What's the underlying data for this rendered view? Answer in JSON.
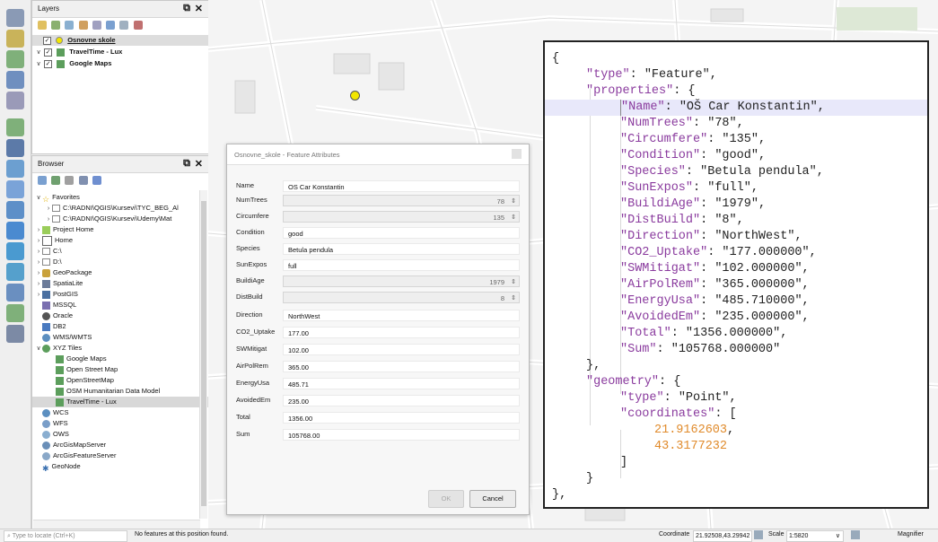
{
  "layers_panel": {
    "title": "Layers",
    "items": [
      {
        "label": "Osnovne skole",
        "checked": true
      },
      {
        "label": "TravelTime - Lux",
        "checked": true
      },
      {
        "label": "Google Maps",
        "checked": true
      }
    ]
  },
  "browser_panel": {
    "title": "Browser",
    "items": [
      {
        "label": "Favorites"
      },
      {
        "label": "C:\\RADNI\\QGIS\\Kursevi\\TYC_BEG_Al"
      },
      {
        "label": "C:\\RADNI\\QGIS\\Kursevi\\Udemy\\Mat"
      },
      {
        "label": "Project Home"
      },
      {
        "label": "Home"
      },
      {
        "label": "C:\\"
      },
      {
        "label": "D:\\"
      },
      {
        "label": "GeoPackage"
      },
      {
        "label": "SpatiaLite"
      },
      {
        "label": "PostGIS"
      },
      {
        "label": "MSSQL"
      },
      {
        "label": "Oracle"
      },
      {
        "label": "DB2"
      },
      {
        "label": "WMS/WMTS"
      },
      {
        "label": "XYZ Tiles"
      },
      {
        "label": "Google Maps"
      },
      {
        "label": "Open Street Map"
      },
      {
        "label": "OpenStreetMap"
      },
      {
        "label": "OSM Humanitarian Data Model"
      },
      {
        "label": "TravelTime - Lux"
      },
      {
        "label": "WCS"
      },
      {
        "label": "WFS"
      },
      {
        "label": "OWS"
      },
      {
        "label": "ArcGisMapServer"
      },
      {
        "label": "ArcGisFeatureServer"
      },
      {
        "label": "GeoNode"
      }
    ]
  },
  "dialog": {
    "title": "Osnovne_skole - Feature Attributes",
    "fields": [
      {
        "label": "Name",
        "value": "OS Car Konstantin"
      },
      {
        "label": "NumTrees",
        "value": "78"
      },
      {
        "label": "Circumfere",
        "value": "135"
      },
      {
        "label": "Condition",
        "value": "good"
      },
      {
        "label": "Species",
        "value": "Betula pendula"
      },
      {
        "label": "SunExpos",
        "value": "full"
      },
      {
        "label": "BuildiAge",
        "value": "1979"
      },
      {
        "label": "DistBuild",
        "value": "8"
      },
      {
        "label": "Direction",
        "value": "NorthWest"
      },
      {
        "label": "CO2_Uptake",
        "value": "177.00"
      },
      {
        "label": "SWMitigat",
        "value": "102.00"
      },
      {
        "label": "AirPolRem",
        "value": "365.00"
      },
      {
        "label": "EnergyUsa",
        "value": "485.71"
      },
      {
        "label": "AvoidedEm",
        "value": "235.00"
      },
      {
        "label": "Total",
        "value": "1356.00"
      },
      {
        "label": "Sum",
        "value": "105768.00"
      }
    ],
    "ok_label": "OK",
    "cancel_label": "Cancel"
  },
  "json_view": {
    "lines": [
      {
        "indent": 0,
        "parts": [
          {
            "t": "{",
            "c": "p"
          }
        ]
      },
      {
        "indent": 1,
        "parts": [
          {
            "t": "\"type\"",
            "c": "k"
          },
          {
            "t": ": ",
            "c": "p"
          },
          {
            "t": "\"Feature\"",
            "c": "s"
          },
          {
            "t": ",",
            "c": "p"
          }
        ]
      },
      {
        "indent": 1,
        "parts": [
          {
            "t": "\"properties\"",
            "c": "k"
          },
          {
            "t": ": {",
            "c": "p"
          }
        ]
      },
      {
        "indent": 2,
        "parts": [
          {
            "t": "\"Name\"",
            "c": "k"
          },
          {
            "t": ": ",
            "c": "p"
          },
          {
            "t": "\"OŠ Car Konstantin\"",
            "c": "s"
          },
          {
            "t": ",",
            "c": "p"
          }
        ],
        "highlight": true
      },
      {
        "indent": 2,
        "parts": [
          {
            "t": "\"NumTrees\"",
            "c": "k"
          },
          {
            "t": ": ",
            "c": "p"
          },
          {
            "t": "\"78\"",
            "c": "s"
          },
          {
            "t": ",",
            "c": "p"
          }
        ]
      },
      {
        "indent": 2,
        "parts": [
          {
            "t": "\"Circumfere\"",
            "c": "k"
          },
          {
            "t": ": ",
            "c": "p"
          },
          {
            "t": "\"135\"",
            "c": "s"
          },
          {
            "t": ",",
            "c": "p"
          }
        ]
      },
      {
        "indent": 2,
        "parts": [
          {
            "t": "\"Condition\"",
            "c": "k"
          },
          {
            "t": ": ",
            "c": "p"
          },
          {
            "t": "\"good\"",
            "c": "s"
          },
          {
            "t": ",",
            "c": "p"
          }
        ]
      },
      {
        "indent": 2,
        "parts": [
          {
            "t": "\"Species\"",
            "c": "k"
          },
          {
            "t": ": ",
            "c": "p"
          },
          {
            "t": "\"Betula pendula\"",
            "c": "s"
          },
          {
            "t": ",",
            "c": "p"
          }
        ]
      },
      {
        "indent": 2,
        "parts": [
          {
            "t": "\"SunExpos\"",
            "c": "k"
          },
          {
            "t": ": ",
            "c": "p"
          },
          {
            "t": "\"full\"",
            "c": "s"
          },
          {
            "t": ",",
            "c": "p"
          }
        ]
      },
      {
        "indent": 2,
        "parts": [
          {
            "t": "\"BuildiAge\"",
            "c": "k"
          },
          {
            "t": ": ",
            "c": "p"
          },
          {
            "t": "\"1979\"",
            "c": "s"
          },
          {
            "t": ",",
            "c": "p"
          }
        ]
      },
      {
        "indent": 2,
        "parts": [
          {
            "t": "\"DistBuild\"",
            "c": "k"
          },
          {
            "t": ": ",
            "c": "p"
          },
          {
            "t": "\"8\"",
            "c": "s"
          },
          {
            "t": ",",
            "c": "p"
          }
        ]
      },
      {
        "indent": 2,
        "parts": [
          {
            "t": "\"Direction\"",
            "c": "k"
          },
          {
            "t": ": ",
            "c": "p"
          },
          {
            "t": "\"NorthWest\"",
            "c": "s"
          },
          {
            "t": ",",
            "c": "p"
          }
        ]
      },
      {
        "indent": 2,
        "parts": [
          {
            "t": "\"CO2_Uptake\"",
            "c": "k"
          },
          {
            "t": ": ",
            "c": "p"
          },
          {
            "t": "\"177.000000\"",
            "c": "s"
          },
          {
            "t": ",",
            "c": "p"
          }
        ]
      },
      {
        "indent": 2,
        "parts": [
          {
            "t": "\"SWMitigat\"",
            "c": "k"
          },
          {
            "t": ": ",
            "c": "p"
          },
          {
            "t": "\"102.000000\"",
            "c": "s"
          },
          {
            "t": ",",
            "c": "p"
          }
        ]
      },
      {
        "indent": 2,
        "parts": [
          {
            "t": "\"AirPolRem\"",
            "c": "k"
          },
          {
            "t": ": ",
            "c": "p"
          },
          {
            "t": "\"365.000000\"",
            "c": "s"
          },
          {
            "t": ",",
            "c": "p"
          }
        ]
      },
      {
        "indent": 2,
        "parts": [
          {
            "t": "\"EnergyUsa\"",
            "c": "k"
          },
          {
            "t": ": ",
            "c": "p"
          },
          {
            "t": "\"485.710000\"",
            "c": "s"
          },
          {
            "t": ",",
            "c": "p"
          }
        ]
      },
      {
        "indent": 2,
        "parts": [
          {
            "t": "\"AvoidedEm\"",
            "c": "k"
          },
          {
            "t": ": ",
            "c": "p"
          },
          {
            "t": "\"235.000000\"",
            "c": "s"
          },
          {
            "t": ",",
            "c": "p"
          }
        ]
      },
      {
        "indent": 2,
        "parts": [
          {
            "t": "\"Total\"",
            "c": "k"
          },
          {
            "t": ": ",
            "c": "p"
          },
          {
            "t": "\"1356.000000\"",
            "c": "s"
          },
          {
            "t": ",",
            "c": "p"
          }
        ]
      },
      {
        "indent": 2,
        "parts": [
          {
            "t": "\"Sum\"",
            "c": "k"
          },
          {
            "t": ": ",
            "c": "p"
          },
          {
            "t": "\"105768.000000\"",
            "c": "s"
          }
        ]
      },
      {
        "indent": 1,
        "parts": [
          {
            "t": "},",
            "c": "p"
          }
        ]
      },
      {
        "indent": 1,
        "parts": [
          {
            "t": "\"geometry\"",
            "c": "k"
          },
          {
            "t": ": {",
            "c": "p"
          }
        ]
      },
      {
        "indent": 2,
        "parts": [
          {
            "t": "\"type\"",
            "c": "k"
          },
          {
            "t": ": ",
            "c": "p"
          },
          {
            "t": "\"Point\"",
            "c": "s"
          },
          {
            "t": ",",
            "c": "p"
          }
        ]
      },
      {
        "indent": 2,
        "parts": [
          {
            "t": "\"coordinates\"",
            "c": "k"
          },
          {
            "t": ": [",
            "c": "p"
          }
        ]
      },
      {
        "indent": 3,
        "parts": [
          {
            "t": "21.9162603",
            "c": "n"
          },
          {
            "t": ",",
            "c": "p"
          }
        ]
      },
      {
        "indent": 3,
        "parts": [
          {
            "t": "43.3177232",
            "c": "n"
          }
        ]
      },
      {
        "indent": 2,
        "parts": [
          {
            "t": "]",
            "c": "p"
          }
        ]
      },
      {
        "indent": 1,
        "parts": [
          {
            "t": "}",
            "c": "p"
          }
        ]
      },
      {
        "indent": 0,
        "parts": [
          {
            "t": "},",
            "c": "p"
          }
        ]
      }
    ]
  },
  "status": {
    "locator_placeholder": "Type to locate (Ctrl+K)",
    "message": "No features at this position found.",
    "coordinate_label": "Coordinate",
    "coordinate_value": "21.92508,43.29942",
    "scale_label": "Scale",
    "scale_value": "1:5820",
    "magnifier_label": "Magnifier"
  },
  "colors": {
    "json_key": "#8a3b9e",
    "json_number": "#e08a2a",
    "highlight": "#e8e8fa",
    "map_marker": "#f2e600"
  }
}
